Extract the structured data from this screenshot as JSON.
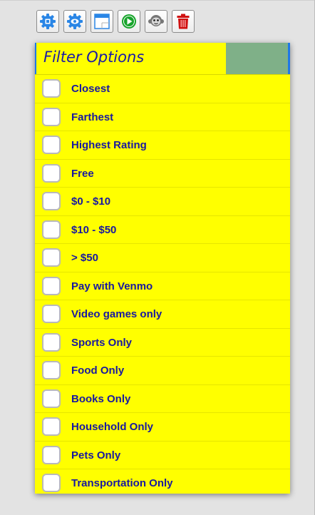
{
  "toolbar": {
    "buttons": [
      {
        "name": "settings-gear-icon",
        "color": "#2a86e6"
      },
      {
        "name": "visibility-gear-icon",
        "color": "#2a86e6"
      },
      {
        "name": "window-icon",
        "color": "#2a86e6"
      },
      {
        "name": "play-icon",
        "color": "#17a42b"
      },
      {
        "name": "monkey-icon",
        "color": "#777777"
      },
      {
        "name": "trash-icon",
        "color": "#d01010"
      }
    ]
  },
  "panel": {
    "title": "Filter Options",
    "background": "#ffff00",
    "text_color": "#1818a0",
    "options": [
      {
        "label": "Closest",
        "checked": false
      },
      {
        "label": "Farthest",
        "checked": false
      },
      {
        "label": "Highest Rating",
        "checked": false
      },
      {
        "label": "Free",
        "checked": false
      },
      {
        "label": "$0 - $10",
        "checked": false
      },
      {
        "label": "$10 - $50",
        "checked": false
      },
      {
        "label": "> $50",
        "checked": false
      },
      {
        "label": "Pay with Venmo",
        "checked": false
      },
      {
        "label": "Video games only",
        "checked": false
      },
      {
        "label": "Sports Only",
        "checked": false
      },
      {
        "label": "Food Only",
        "checked": false
      },
      {
        "label": "Books Only",
        "checked": false
      },
      {
        "label": "Household Only",
        "checked": false
      },
      {
        "label": "Pets Only",
        "checked": false
      },
      {
        "label": "Transportation Only",
        "checked": false
      }
    ]
  }
}
